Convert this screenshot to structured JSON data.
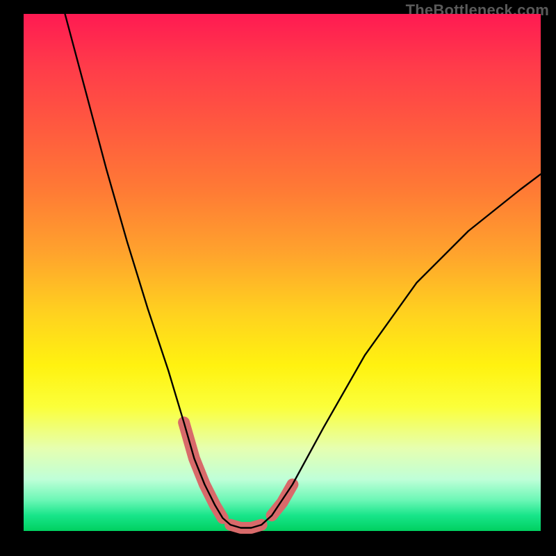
{
  "watermark": "TheBottleneck.com",
  "colors": {
    "accent": "#d86a6a",
    "curve": "#000000",
    "frame": "#000000"
  },
  "chart_data": {
    "type": "line",
    "title": "",
    "xlabel": "",
    "ylabel": "",
    "xlim": [
      0,
      100
    ],
    "ylim": [
      0,
      100
    ],
    "grid": false,
    "legend": false,
    "series": [
      {
        "name": "bottleneck-curve",
        "x": [
          8,
          12,
          16,
          20,
          24,
          28,
          31,
          33,
          35,
          37,
          38.5,
          40,
          42,
          44,
          46,
          48,
          52,
          58,
          66,
          76,
          86,
          96,
          100
        ],
        "y": [
          100,
          85,
          70,
          56,
          43,
          31,
          21,
          14,
          9,
          5,
          2.5,
          1.2,
          0.6,
          0.6,
          1.2,
          3,
          9,
          20,
          34,
          48,
          58,
          66,
          69
        ]
      }
    ],
    "accent_segments": [
      {
        "name": "left-descent",
        "x": [
          31,
          33,
          35,
          37,
          38.5
        ],
        "y": [
          21,
          14,
          9,
          5,
          2.5
        ]
      },
      {
        "name": "valley-floor",
        "x": [
          40,
          42,
          44,
          46
        ],
        "y": [
          1.2,
          0.6,
          0.6,
          1.2
        ]
      },
      {
        "name": "right-ascent",
        "x": [
          48,
          50,
          52
        ],
        "y": [
          3,
          5.5,
          9
        ]
      }
    ]
  }
}
